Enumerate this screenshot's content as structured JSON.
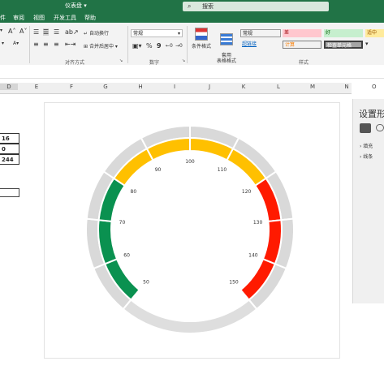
{
  "title_bar": {
    "doc_name": "仪表盘 ▾",
    "search_icon": "search-icon",
    "search_text": "搜索"
  },
  "menu": [
    "件",
    "审阅",
    "视图",
    "开发工具",
    "帮助"
  ],
  "ribbon": {
    "font_size_up": "A˄",
    "font_size_down": "A˅",
    "wrap_text": "自动换行",
    "merge_center": "合并后居中 ▾",
    "alignment_group": "对齐方式",
    "number_format": "常规",
    "percent": "%",
    "comma": "9",
    "number_group": "数字",
    "cond_format": "条件格式",
    "table_format": "套用\n表格格式",
    "styles_group": "样式",
    "style_cells": [
      {
        "label": "常规",
        "bg": "#ffffff",
        "fg": "#000000"
      },
      {
        "label": "差",
        "bg": "#ffc7ce",
        "fg": "#9c0006"
      },
      {
        "label": "好",
        "bg": "#c6efce",
        "fg": "#006100"
      },
      {
        "label": "适中",
        "bg": "#ffeb9c",
        "fg": "#9c5700"
      },
      {
        "label": "超链接",
        "bg": "#ffffff",
        "fg": "#0563c1"
      },
      {
        "label": "计算",
        "bg": "#f2f2f2",
        "fg": "#fa7d00"
      },
      {
        "label": "检查单元格",
        "bg": "#a5a5a5",
        "fg": "#ffffff"
      }
    ]
  },
  "columns": [
    "D",
    "E",
    "F",
    "G",
    "H",
    "I",
    "J",
    "K",
    "L",
    "M",
    "N",
    "O"
  ],
  "cells": [
    "16",
    "0",
    "244"
  ],
  "format_pane": {
    "title": "设置形",
    "items": [
      "› 填充",
      "› 线条"
    ]
  },
  "chart_data": {
    "type": "gauge",
    "ticks": [
      50,
      60,
      70,
      80,
      90,
      100,
      110,
      120,
      130,
      140,
      150
    ],
    "range": [
      50,
      150
    ],
    "bands": [
      {
        "from": 50,
        "to": 80,
        "color": "#0a9150"
      },
      {
        "from": 80,
        "to": 120,
        "color": "#ffc000"
      },
      {
        "from": 120,
        "to": 150,
        "color": "#ff1a00"
      }
    ],
    "track_color": "#d9d9d9",
    "bottom_arc_color": "#dedede"
  }
}
